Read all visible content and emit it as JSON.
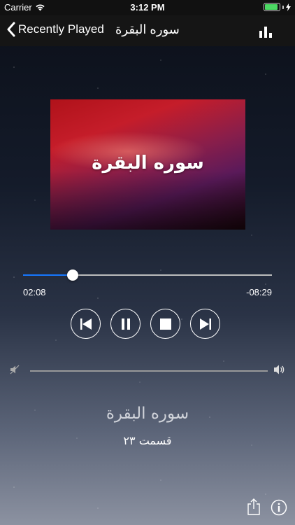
{
  "status_bar": {
    "carrier": "Carrier",
    "time": "3:12 PM",
    "battery_color": "#4cd964"
  },
  "nav": {
    "back_label": "Recently Played",
    "title": "سوره البقرة",
    "equalizer_icon": "bar-chart-icon"
  },
  "artwork": {
    "title": "سوره البقرة"
  },
  "playback": {
    "elapsed": "02:08",
    "remaining": "-08:29",
    "progress_fraction": 0.2,
    "accent_color": "#1677ff"
  },
  "controls": {
    "previous_icon": "skip-previous-icon",
    "pause_icon": "pause-icon",
    "stop_icon": "stop-icon",
    "next_icon": "skip-next-icon"
  },
  "volume": {
    "low_icon": "volume-mute-icon",
    "high_icon": "volume-high-icon"
  },
  "track": {
    "title": "سوره البقرة",
    "subtitle": "قسمت ۲۳"
  },
  "footer": {
    "share_icon": "share-icon",
    "info_icon": "info-icon"
  }
}
